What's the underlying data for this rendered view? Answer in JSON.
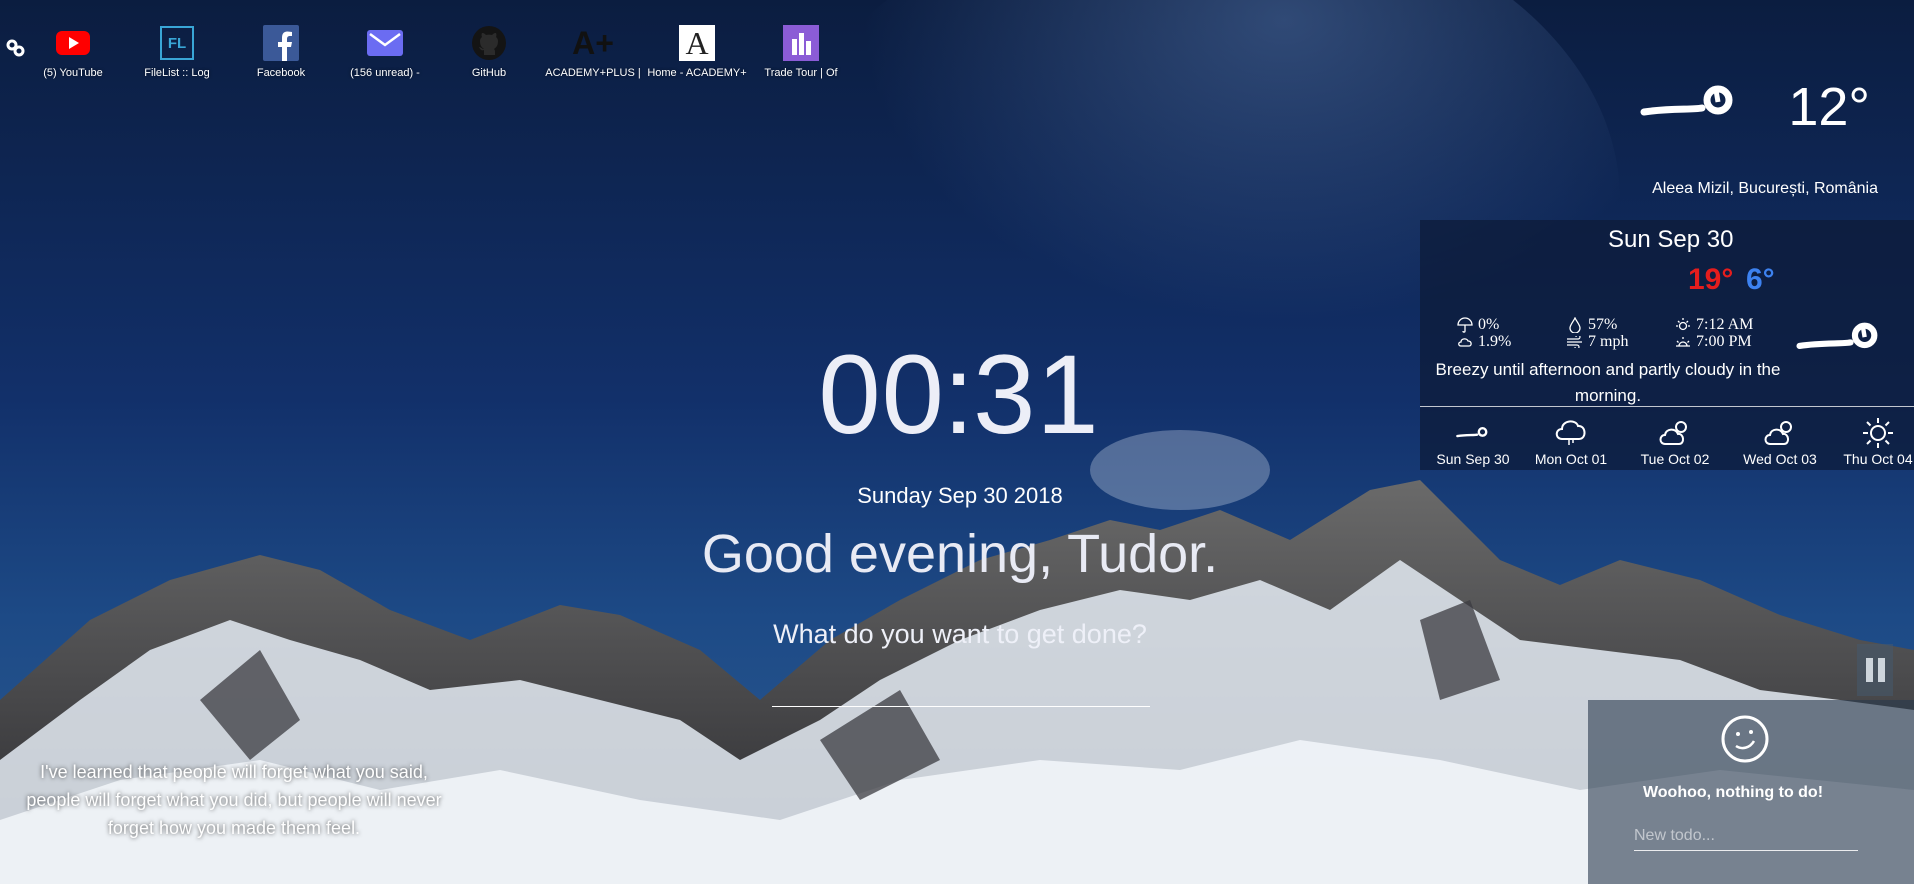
{
  "bookmarks": [
    {
      "label": "(5) YouTube",
      "icon": "youtube-icon"
    },
    {
      "label": "FileList :: Log",
      "icon": "filelist-icon",
      "icon_text": "FL"
    },
    {
      "label": "Facebook",
      "icon": "facebook-icon"
    },
    {
      "label": "(156 unread) -",
      "icon": "mail-icon"
    },
    {
      "label": "GitHub",
      "icon": "github-icon"
    },
    {
      "label": "ACADEMY+PLUS |",
      "icon": "academy-plus-icon",
      "icon_text": "A+"
    },
    {
      "label": "Home - ACADEMY+",
      "icon": "academy-home-icon",
      "icon_text": "A"
    },
    {
      "label": "Trade Tour | Of",
      "icon": "trade-tour-icon"
    }
  ],
  "weather": {
    "current_temp": "12°",
    "location": "Aleea Mizil, București, România",
    "current_icon": "wind-icon"
  },
  "forecast": {
    "date": "Sun Sep 30",
    "high": "19°",
    "low": "6°",
    "precip_prob": "0%",
    "precip_amount": "1.9%",
    "humidity": "57%",
    "wind": "7 mph",
    "sunrise": "7:12 AM",
    "sunset": "7:00 PM",
    "summary": "Breezy until afternoon and partly cloudy in the morning.",
    "days": [
      {
        "label": "Sun Sep 30",
        "icon": "wind-icon"
      },
      {
        "label": "Mon Oct 01",
        "icon": "cloud-icon"
      },
      {
        "label": "Tue Oct 02",
        "icon": "partly-cloudy-icon"
      },
      {
        "label": "Wed Oct 03",
        "icon": "partly-cloudy-icon"
      },
      {
        "label": "Thu Oct 04",
        "icon": "sun-icon"
      }
    ]
  },
  "clock": {
    "hours": "00",
    "separator": ":",
    "minutes": "31"
  },
  "date": "Sunday Sep 30 2018",
  "greeting": "Good evening, Tudor.",
  "focus": {
    "question": "What do you want to get done?",
    "value": ""
  },
  "quote": "I've learned that people will forget what you said, people will forget what you did, but people will never forget how you made them feel.",
  "todo": {
    "empty_text": "Woohoo, nothing to do!",
    "placeholder": "New todo..."
  },
  "colors": {
    "high": "#e51d1d",
    "low": "#3d82f0",
    "youtube": "#ff0000",
    "facebook": "#3b5998",
    "mail": "#6b6cf2"
  }
}
